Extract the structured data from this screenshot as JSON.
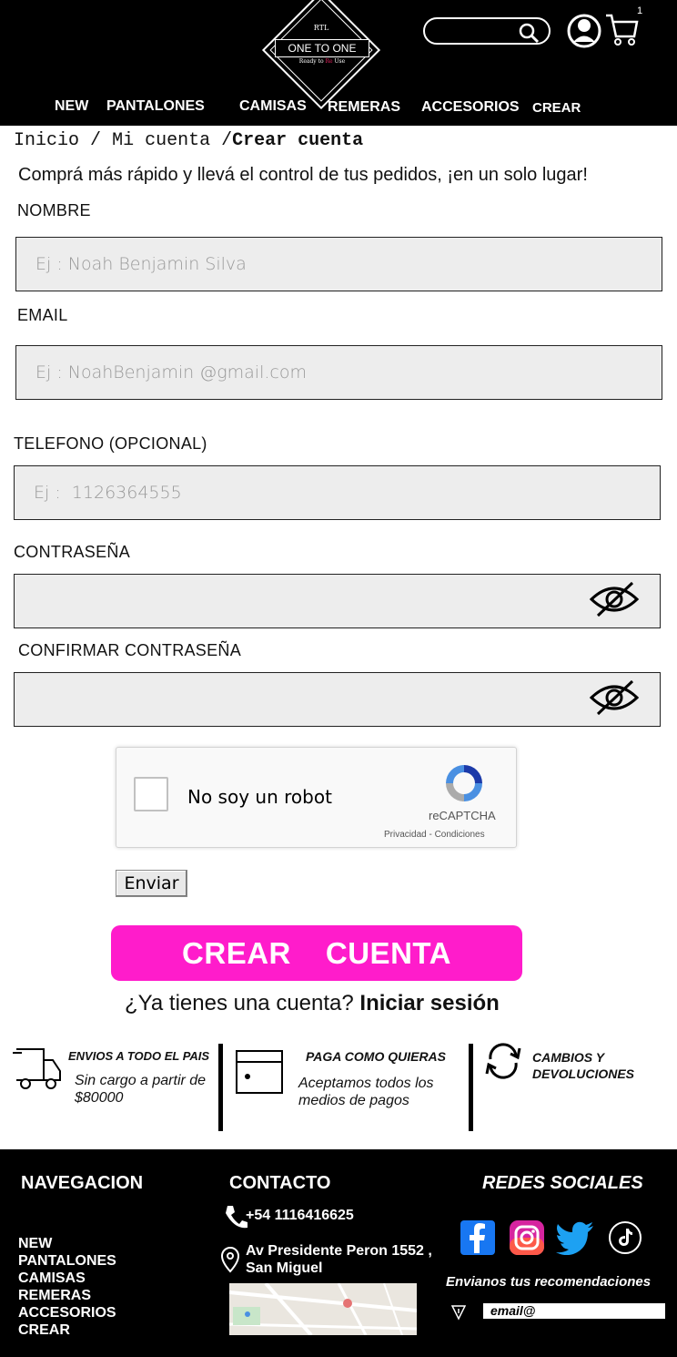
{
  "header": {
    "logo_text": "ONE TO ONE",
    "logo_crest": "RTL",
    "logo_tagline_a": "Ready to ",
    "logo_tagline_red": "Re",
    "logo_tagline_b": " Use",
    "cart_count": "1",
    "nav": [
      "NEW",
      "PANTALONES",
      "CAMISAS",
      "REMERAS",
      "ACCESORIOS",
      "CREAR"
    ]
  },
  "breadcrumb": {
    "home": "Inicio",
    "sep": "/",
    "account": "Mi cuenta",
    "current": "Crear cuenta"
  },
  "intro": "Comprá más rápido y llevá el control de tus pedidos, ¡en un solo lugar!",
  "form": {
    "name_label": "NOMBRE",
    "name_placeholder": "Ej : Noah Benjamin Silva",
    "email_label": "EMAIL",
    "email_placeholder": "Ej : NoahBenjamin @gmail.com",
    "phone_label": "TELEFONO  (OPCIONAL)",
    "phone_placeholder": "Ej :  1126364555",
    "password_label": "CONTRASEÑA",
    "confirm_label": "CONFIRMAR  CONTRASEÑA"
  },
  "recaptcha": {
    "label": "No soy un robot",
    "brand": "reCAPTCHA",
    "privacy": "Privacidad - Condiciones"
  },
  "send_label": "Enviar",
  "create_button": {
    "word1": "CREAR",
    "word2": "CUENTA"
  },
  "login": {
    "question": "¿Ya tienes una cuenta?",
    "link": "Iniciar sesión"
  },
  "features": {
    "shipping_title": "ENVIOS A TODO EL PAIS",
    "shipping_text": "Sin cargo a partir de $80000",
    "payment_title": "PAGA COMO QUIERAS",
    "payment_text": "Aceptamos todos los medios de pagos",
    "returns_title": "CAMBIOS Y DEVOLUCIONES"
  },
  "footer": {
    "nav_title": "NAVEGACION",
    "nav_items": [
      "NEW",
      "PANTALONES",
      "CAMISAS",
      "REMERAS",
      "ACCESORIOS",
      "CREAR"
    ],
    "contact_title": "CONTACTO",
    "phone": "+54 1116416625",
    "address": "Av Presidente Peron 1552 , San Miguel",
    "social_title": "REDES SOCIALES",
    "recommend": "Envianos tus recomendaciones",
    "email_placeholder": "email@"
  },
  "colors": {
    "accent": "#ff1ccb",
    "header_bg": "#000000",
    "footer_bg": "#000000"
  }
}
